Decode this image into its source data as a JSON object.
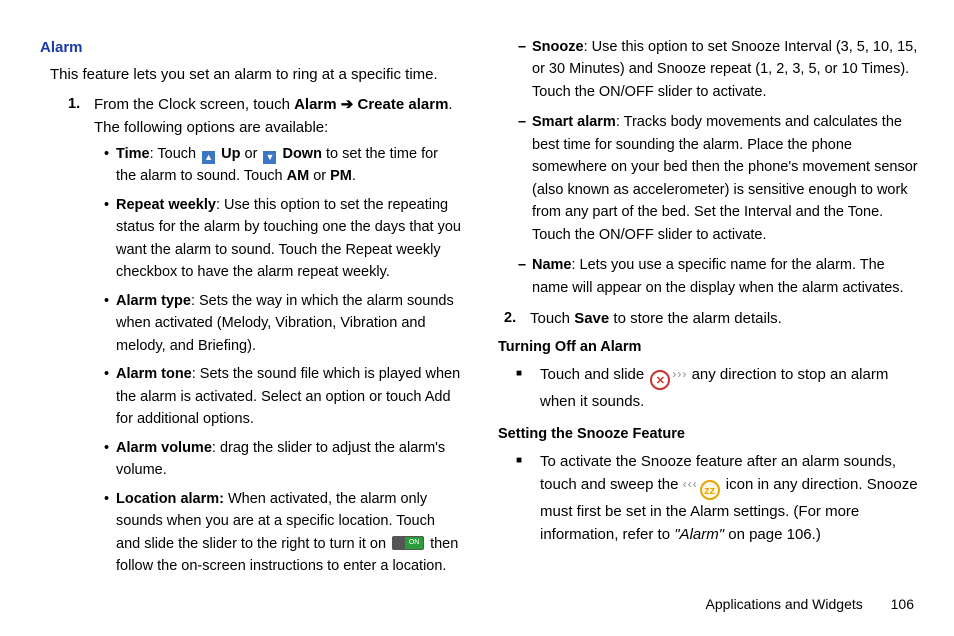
{
  "heading": "Alarm",
  "intro": "This feature lets you set an alarm to ring at a specific time.",
  "step1": {
    "num": "1.",
    "lead": "From the Clock screen, touch ",
    "alarm": "Alarm",
    "arrow": " ➔ ",
    "create": "Create alarm",
    "tail": ". The following options are available:"
  },
  "b_time": {
    "label": "Time",
    "p1": ": Touch ",
    "up": " Up",
    "or": " or ",
    "down": " Down",
    "p2": " to set the time for the alarm to sound. Touch ",
    "am": "AM",
    "or2": " or ",
    "pm": "PM",
    "dot": "."
  },
  "b_repeat": {
    "label": "Repeat weekly",
    "text": ": Use this option to set the repeating status for the alarm by touching one the days that you want the alarm to sound. Touch the Repeat weekly checkbox to have the alarm repeat weekly."
  },
  "b_type": {
    "label": "Alarm type",
    "text": ": Sets the way in which the alarm sounds when activated (Melody, Vibration, Vibration and melody, and Briefing)."
  },
  "b_tone": {
    "label": "Alarm tone",
    "text": ": Sets the sound file which is played when the alarm is activated. Select an option or touch Add for additional options."
  },
  "b_volume": {
    "label": "Alarm volume",
    "text": ": drag the slider to adjust the alarm's volume."
  },
  "b_location": {
    "label": "Location alarm:",
    "p1": " When activated, the alarm only sounds when you are at a specific location. Touch and slide the slider to the right to turn it on ",
    "p2": " then follow the on-screen instructions to enter a location."
  },
  "d_snooze": {
    "label": "Snooze",
    "text": ": Use this option to set Snooze Interval (3, 5, 10, 15, or 30 Minutes) and Snooze repeat (1, 2, 3, 5, or 10 Times). Touch the ON/OFF slider to activate."
  },
  "d_smart": {
    "label": "Smart alarm",
    "text": ": Tracks body movements and calculates the best time for sounding the alarm. Place the phone somewhere on your bed then the phone's movement sensor (also known as accelerometer) is sensitive enough to work from any part of the bed. Set the Interval and the Tone. Touch the ON/OFF slider to activate."
  },
  "d_name": {
    "label": "Name",
    "text": ": Lets you use a specific name for the alarm. The name will appear on the display when the alarm activates."
  },
  "step2": {
    "num": "2.",
    "p1": "Touch ",
    "save": "Save",
    "p2": " to store the alarm details."
  },
  "sub_off": "Turning Off an Alarm",
  "off_item": {
    "p1": "Touch and slide ",
    "p2": " any direction to stop an alarm when it sounds."
  },
  "sub_snooze": "Setting the Snooze Feature",
  "sn_item": {
    "p1": "To activate the Snooze feature after an alarm sounds, touch and sweep the ",
    "p2": " icon in any direction. Snooze must first be set in the Alarm settings. (For more information, refer to ",
    "ref": "\"Alarm\"",
    "p3": " on page 106.)"
  },
  "footer": {
    "section": "Applications and Widgets",
    "page": "106"
  }
}
